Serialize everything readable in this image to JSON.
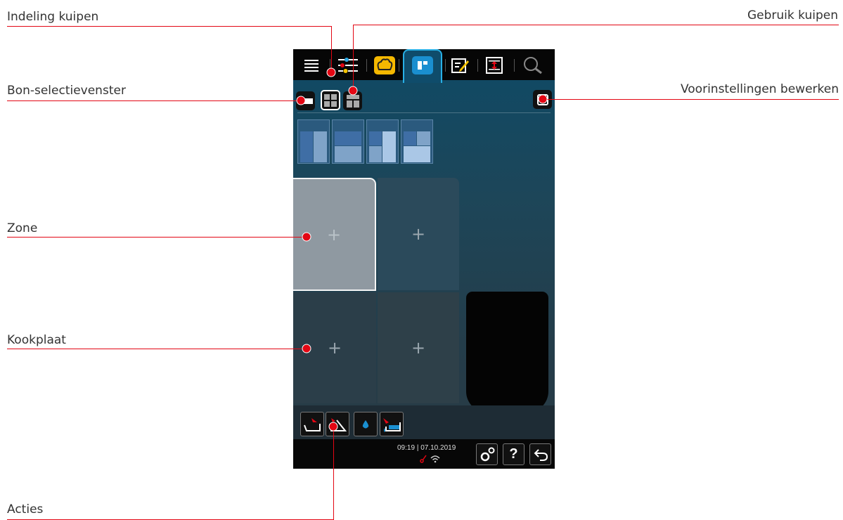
{
  "callouts": {
    "indeling_kuipen": "Indeling kuipen",
    "gebruik_kuipen": "Gebruik kuipen",
    "bon_selectievenster": "Bon-selectievenster",
    "voorinstellingen_bewerken": "Voorinstellingen bewerken",
    "zone": "Zone",
    "kookplaat": "Kookplaat",
    "acties": "Acties"
  },
  "screen": {
    "zone_symbol": "+",
    "status": {
      "time": "09:19",
      "date": "07.10.2019"
    },
    "help_label": "?"
  },
  "colors": {
    "accent_red": "#e30613",
    "active_tab_border": "#28b0e6",
    "screen_top": "#0e4a66",
    "screen_bottom": "#2a3a44"
  },
  "icons": {
    "menu": "list-icon",
    "filter": "sliders-icon",
    "chef": "chef-hat-icon",
    "wells": "wells-layout-icon",
    "edit": "edit-icon",
    "sort": "sort-icon",
    "search": "search-icon",
    "settings": "gears-icon",
    "back": "back-arrow-icon"
  }
}
